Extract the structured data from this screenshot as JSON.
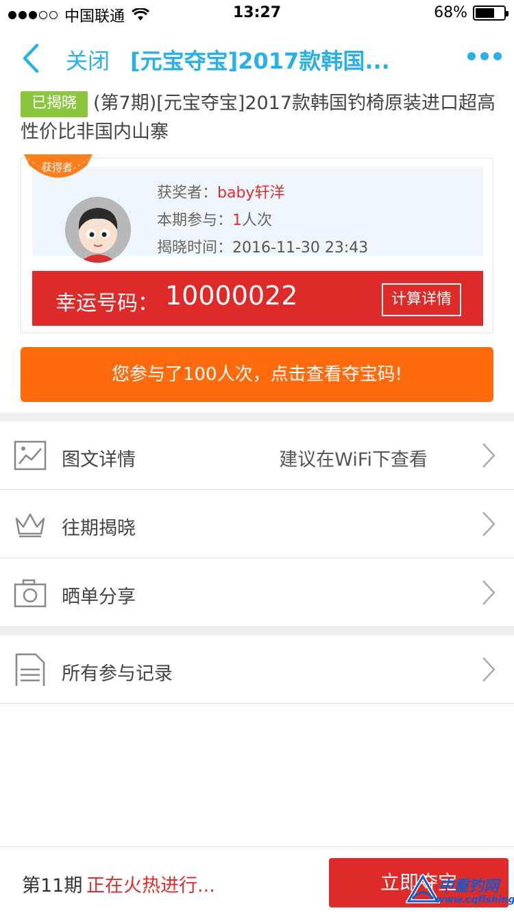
{
  "status_bar": {
    "carrier": "中国联通",
    "time": "13:27",
    "battery": "68%",
    "battery_level": 0.68
  },
  "nav": {
    "close_label": "关闭",
    "title": "[元宝夺宝]2017款韩国..."
  },
  "product": {
    "badge": "已揭晓",
    "title": "(第7期)[元宝夺宝]2017款韩国钓椅原装进口超高性价比非国内山寨"
  },
  "winner": {
    "ribbon": "获得者",
    "winner_label": "获奖者：",
    "winner_name": "baby轩洋",
    "participation_label": "本期参与：",
    "participation_count": "1",
    "participation_unit": "人次",
    "reveal_label": "揭晓时间：",
    "reveal_time": "2016-11-30 23:43"
  },
  "lucky": {
    "label": "幸运号码：",
    "number": "10000022",
    "calc_button": "计算详情"
  },
  "participate_button": "您参与了100人次，点击查看夺宝码!",
  "menu": {
    "details": {
      "label": "图文详情",
      "hint": "建议在WiFi下查看"
    },
    "history": {
      "label": "往期揭晓"
    },
    "share": {
      "label": "晒单分享"
    },
    "records": {
      "label": "所有参与记录"
    }
  },
  "bottom": {
    "period": "第11期",
    "status": "正在火热进行...",
    "buy_button": "立即夺宝",
    "watermark_text": "中重钓网",
    "watermark_url": "www.cqfishing.net"
  },
  "colors": {
    "accent": "#2ab0e8",
    "red": "#df2a2a",
    "orange": "#ff6a0c",
    "green": "#8cc63f"
  }
}
